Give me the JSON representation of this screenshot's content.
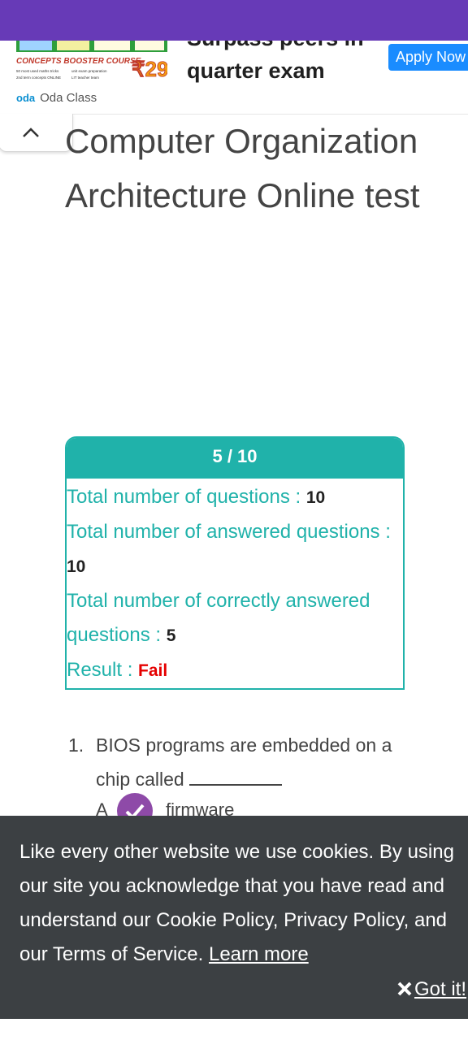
{
  "ad": {
    "image_caption": "CONCEPTS BOOSTER COURSE",
    "image_bullets": [
      "50 most used maths tricks",
      "unit exam preparation",
      "2nd term concepts ONLINE",
      "LIT teacher team"
    ],
    "image_price": "₹29",
    "headline_line1": "Surpass peers in",
    "headline_line2": "quarter exam",
    "brand_logo": "oda",
    "brand_name": "Oda Class",
    "apply_label": "Apply Now"
  },
  "collapse": {
    "icon": "chevron-up-icon"
  },
  "page": {
    "title": "Computer Organization Architecture Online test"
  },
  "result": {
    "score": "5 / 10",
    "total_label": "Total number of questions : ",
    "total_value": "10",
    "answered_label": "Total number of answered questions : ",
    "answered_value": "10",
    "correct_label": "Total number of correctly answered questions : ",
    "correct_value": "5",
    "result_label": "Result : ",
    "result_value": "Fail"
  },
  "question": {
    "number": "1.",
    "text": "BIOS programs are embedded on a chip called",
    "options": [
      {
        "letter": "A",
        "text": "firmware",
        "icon": "check-icon"
      }
    ]
  },
  "cookie": {
    "text": "Like every other website we use cookies. By using our site you acknowledge that you have read and understand our Cookie Policy, Privacy Policy, and our Terms of Service.",
    "learn_more": "Learn more",
    "got_it": "Got it!"
  },
  "colors": {
    "status_bar": "#673ab7",
    "teal": "#20b2aa",
    "fail": "#e50000",
    "cookie_bg": "#3c4043",
    "apply": "#1a8cff",
    "check": "#8e4aa8"
  }
}
